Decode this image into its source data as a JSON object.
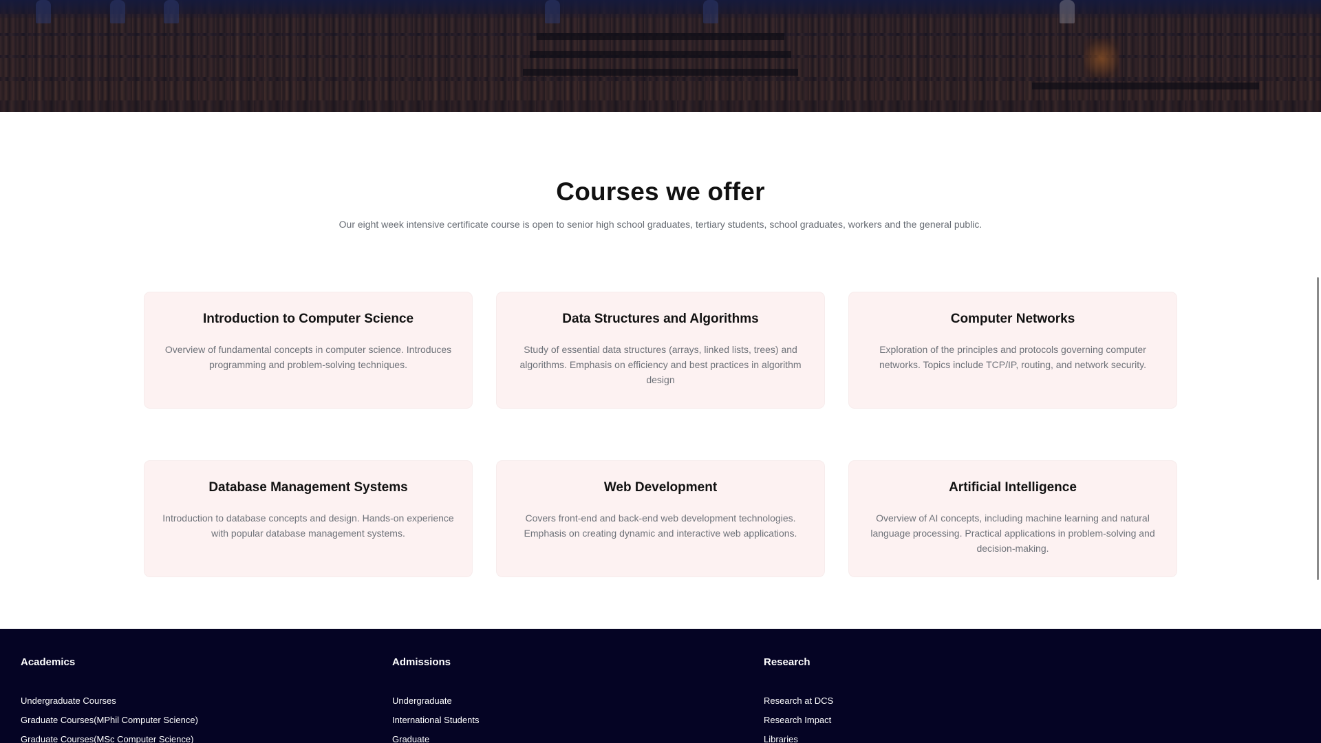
{
  "courses": {
    "title": "Courses we offer",
    "subtitle": "Our eight week intensive certificate course is open to senior high school graduates, tertiary students, school graduates, workers and the general public.",
    "items": [
      {
        "title": "Introduction to Computer Science",
        "description": "Overview of fundamental concepts in computer science. Introduces programming and problem-solving techniques."
      },
      {
        "title": "Data Structures and Algorithms",
        "description": "Study of essential data structures (arrays, linked lists, trees) and algorithms. Emphasis on efficiency and best practices in algorithm design"
      },
      {
        "title": "Computer Networks",
        "description": "Exploration of the principles and protocols governing computer networks. Topics include TCP/IP, routing, and network security."
      },
      {
        "title": "Database Management Systems",
        "description": "Introduction to database concepts and design. Hands-on experience with popular database management systems."
      },
      {
        "title": "Web Development",
        "description": "Covers front-end and back-end web development technologies. Emphasis on creating dynamic and interactive web applications."
      },
      {
        "title": "Artificial Intelligence",
        "description": "Overview of AI concepts, including machine learning and natural language processing. Practical applications in problem-solving and decision-making."
      }
    ]
  },
  "footer": {
    "columns": [
      {
        "heading": "Academics",
        "links": [
          "Undergraduate Courses",
          "Graduate Courses(MPhil Computer Science)",
          "Graduate Courses(MSc Computer Science)"
        ]
      },
      {
        "heading": "Admissions",
        "links": [
          "Undergraduate",
          "International Students",
          "Graduate"
        ]
      },
      {
        "heading": "Research",
        "links": [
          "Research at DCS",
          "Research Impact",
          "Libraries"
        ]
      }
    ]
  },
  "colors": {
    "card_background": "#fdf2f2",
    "footer_background": "#050424",
    "heading_text": "#111111",
    "body_text": "#6e7279"
  }
}
